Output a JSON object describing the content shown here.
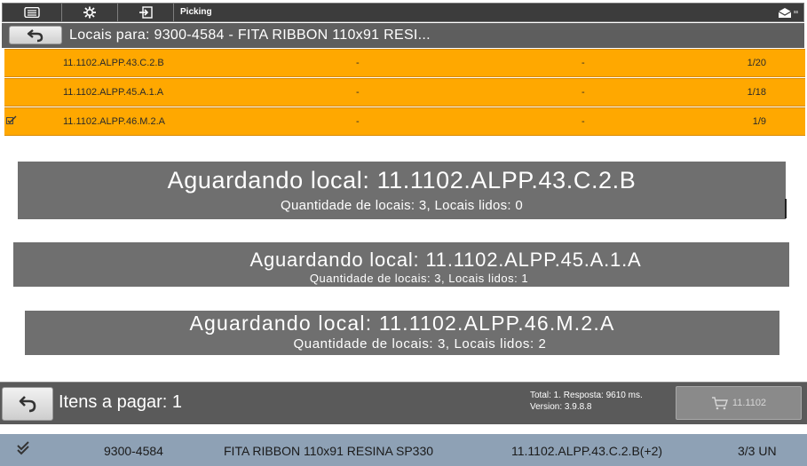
{
  "toolbar": {
    "title": "Picking",
    "icons": [
      "menu-icon",
      "settings-icon",
      "logout-icon"
    ],
    "right_icon": "notification-icon",
    "right_badge": "ss"
  },
  "header": {
    "title": "Locais para: 9300-4584 - FITA RIBBON 110x91 RESI..."
  },
  "locations": [
    {
      "checked": false,
      "local": "11.1102.ALPP.43.C.2.B",
      "col2": "-",
      "col3": "-",
      "count": "1/20"
    },
    {
      "checked": false,
      "local": "11.1102.ALPP.45.A.1.A",
      "col2": "-",
      "col3": "-",
      "count": "1/18"
    },
    {
      "checked": true,
      "local": "11.1102.ALPP.46.M.2.A",
      "col2": "-",
      "col3": "-",
      "count": "1/9"
    }
  ],
  "banners": [
    {
      "title": "Aguardando local: 11.1102.ALPP.43.C.2.B",
      "subtitle": "Quantidade de locais: 3, Locais lidos: 0"
    },
    {
      "title": "Aguardando local: 11.1102.ALPP.45.A.1.A",
      "subtitle": "Quantidade de locais: 3, Locais lidos: 1"
    },
    {
      "title": "Aguardando local: 11.1102.ALPP.46.M.2.A",
      "subtitle": "Quantidade de locais: 3, Locais lidos: 2"
    }
  ],
  "bottom": {
    "items_label": "Itens a pagar: 1",
    "stats_line1": "Total: 1. Resposta: 9610 ms.",
    "stats_line2": "Version: 3.9.8.8",
    "cart_button": "11.1102",
    "item": {
      "check": "✔",
      "code": "9300-4584",
      "description": "FITA RIBBON 110x91 RESINA SP330",
      "location": "11.1102.ALPP.43.C.2.B(+2)",
      "quantity": "3/3 UN"
    }
  },
  "colors": {
    "toolbar_bg": "#3c3c3c",
    "header_bg": "#5e5e5e",
    "row_highlight": "#ffa800",
    "banner_bg": "#6f6f6f",
    "item_row_bg": "#8ea1b5"
  }
}
